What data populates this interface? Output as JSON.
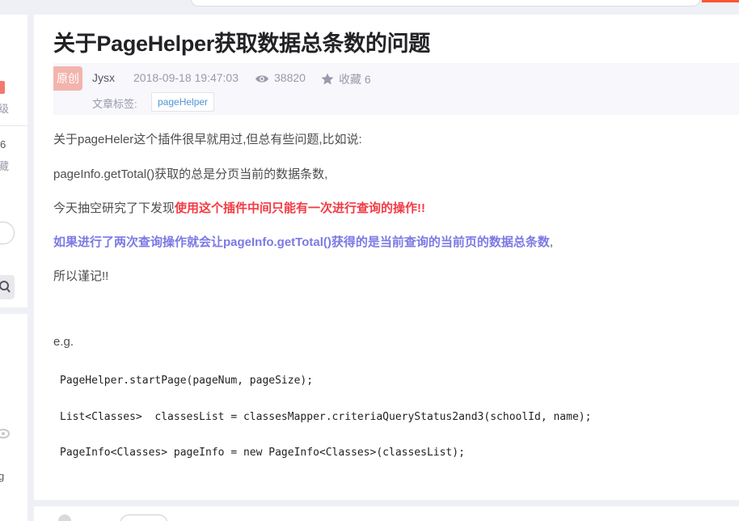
{
  "article": {
    "title": "关于PageHelper获取数据总条数的问题",
    "badge": "原创",
    "author": "Jysx",
    "date": "2018-09-18 19:47:03",
    "views": "38820",
    "favorites": "收藏 6",
    "tags_label": "文章标签:",
    "tags": [
      "pageHelper"
    ]
  },
  "content": {
    "p1": " 关于pageHeler这个插件很早就用过,但总有些问题,比如说:",
    "p2": "pageInfo.getTotal()获取的总是分页当前的数据条数,",
    "p3_prefix": "今天抽空研究了下发现",
    "p3_highlight": "使用这个插件中间只能有一次进行查询的操作!!",
    "p4": "如果进行了两次查询操作就会让pageInfo.getTotal()获得的是当前查询的当前页的数据总条数",
    "p4_suffix": ",",
    "p5": "所以谨记!!",
    "p6": "e.g.",
    "code": [
      "PageHelper.startPage(pageNum, pageSize);",
      "List<Classes>  classesList = classesMapper.criteriaQueryStatus2and3(schoolId, name);",
      "PageInfo<Classes> pageInfo = new PageInfo<Classes>(classesList);"
    ]
  },
  "sidebar": {
    "frag1": "级",
    "frag2": "6",
    "frag3": "藏",
    "frag4": "g"
  },
  "colors": {
    "accent_red": "#f33b45",
    "accent_purple": "#7c79e5",
    "badge": "#f3b4ad",
    "tag": "#5094d5",
    "brand_orange": "#fc5531"
  }
}
